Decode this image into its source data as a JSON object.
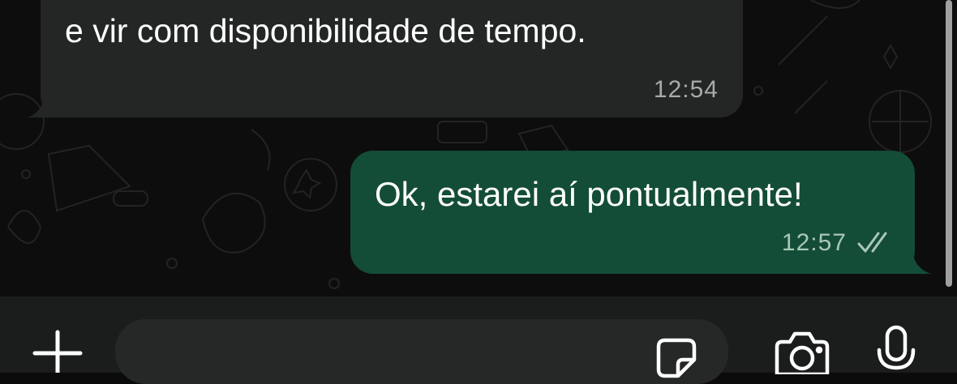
{
  "conversation": {
    "messages": [
      {
        "direction": "incoming",
        "text": "e vir com disponibilidade de tempo.",
        "time": "12:54"
      },
      {
        "direction": "outgoing",
        "text": "Ok, estarei aí pontualmente!",
        "time": "12:57",
        "status_icon": "double-check-icon"
      }
    ]
  },
  "composer": {
    "input_value": "",
    "icons": [
      "plus-icon",
      "sticker-icon",
      "camera-icon",
      "microphone-icon"
    ]
  },
  "colors": {
    "background": "#0d0d0d",
    "incoming_bubble": "#242626",
    "outgoing_bubble": "#144d37",
    "composer_bar": "#1b1c1c",
    "input_field": "#262727",
    "icon": "#ffffff"
  }
}
